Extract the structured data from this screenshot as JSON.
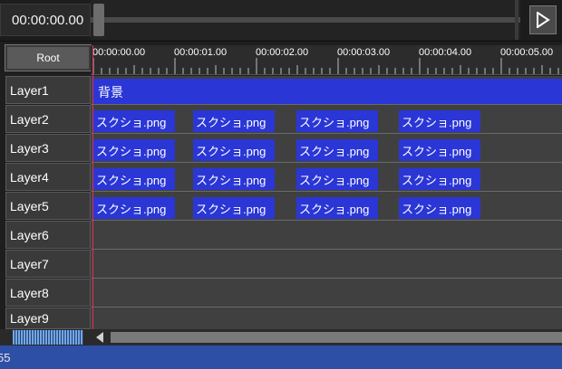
{
  "transport": {
    "timecode": "00:00:00.00",
    "play_icon": "play-icon"
  },
  "layers": {
    "root_label": "Root",
    "items": [
      "Layer1",
      "Layer2",
      "Layer3",
      "Layer4",
      "Layer5",
      "Layer6",
      "Layer7",
      "Layer8",
      "Layer9"
    ]
  },
  "ruler": {
    "labels": [
      "00:00:00.00",
      "00:00:01.00",
      "00:00:02.00",
      "00:00:03.00",
      "00:00:04.00",
      "00:00:05.00"
    ]
  },
  "timeline": {
    "background_clip": "背景",
    "clip_label": "スクショ.png"
  },
  "status": {
    "text": "55"
  },
  "colors": {
    "clip": "#2a36d6",
    "playhead": "#e0305a",
    "status_bar": "#2e4fa6"
  }
}
